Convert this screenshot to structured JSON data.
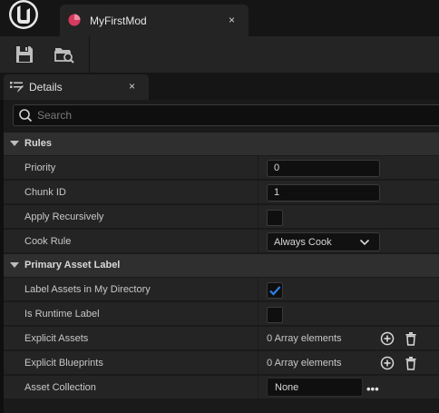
{
  "app": {
    "logo": "unreal-engine-logo-icon"
  },
  "document_tab": {
    "title": "MyFirstMod",
    "icon": "data-asset-icon",
    "close": "×"
  },
  "toolbar": {
    "save_icon": "save-icon",
    "browse_icon": "browse-to-asset-icon"
  },
  "details_tab": {
    "title": "Details",
    "icon": "details-icon",
    "close": "×"
  },
  "search": {
    "placeholder": "Search",
    "value": ""
  },
  "categories": [
    {
      "label": "Rules",
      "rows": [
        {
          "label": "Priority",
          "type": "number",
          "value": "0"
        },
        {
          "label": "Chunk ID",
          "type": "number",
          "value": "1"
        },
        {
          "label": "Apply Recursively",
          "type": "checkbox",
          "checked": false
        },
        {
          "label": "Cook Rule",
          "type": "combo",
          "value": "Always Cook"
        }
      ]
    },
    {
      "label": "Primary Asset Label",
      "rows": [
        {
          "label": "Label Assets in My Directory",
          "type": "checkbox",
          "checked": true
        },
        {
          "label": "Is Runtime Label",
          "type": "checkbox",
          "checked": false
        },
        {
          "label": "Explicit Assets",
          "type": "array",
          "value": "0 Array elements"
        },
        {
          "label": "Explicit Blueprints",
          "type": "array",
          "value": "0 Array elements"
        },
        {
          "label": "Asset Collection",
          "type": "asset",
          "value": "None",
          "more": "•••"
        }
      ]
    }
  ],
  "colors": {
    "accent": "#d63a5e",
    "checkmark": "#2e7fe8",
    "panel": "#242424"
  }
}
